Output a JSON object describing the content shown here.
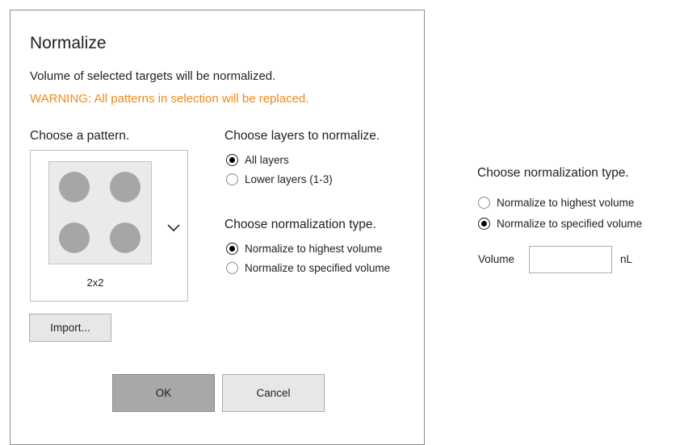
{
  "dialog": {
    "title": "Normalize",
    "description": "Volume of selected targets will be normalized.",
    "warning": "WARNING: All patterns in selection will be replaced.",
    "warning_color": "#f0891c",
    "pattern": {
      "heading": "Choose a pattern.",
      "selected": "2x2",
      "icon": "chevron-down-icon"
    },
    "layers": {
      "heading": "Choose layers to normalize.",
      "options": [
        {
          "label": "All layers",
          "checked": true
        },
        {
          "label": "Lower layers (1-3)",
          "checked": false
        }
      ]
    },
    "normalization": {
      "heading": "Choose normalization type.",
      "options": [
        {
          "label": "Normalize to highest volume",
          "checked": true
        },
        {
          "label": "Normalize to specified volume",
          "checked": false
        }
      ]
    },
    "import_label": "Import...",
    "ok_label": "OK",
    "cancel_label": "Cancel"
  },
  "side_panel": {
    "normalization": {
      "heading": "Choose normalization type.",
      "options": [
        {
          "label": "Normalize to highest volume",
          "checked": false
        },
        {
          "label": "Normalize to specified volume",
          "checked": true
        }
      ]
    },
    "volume_label": "Volume",
    "volume_value": "",
    "volume_unit": "nL"
  }
}
